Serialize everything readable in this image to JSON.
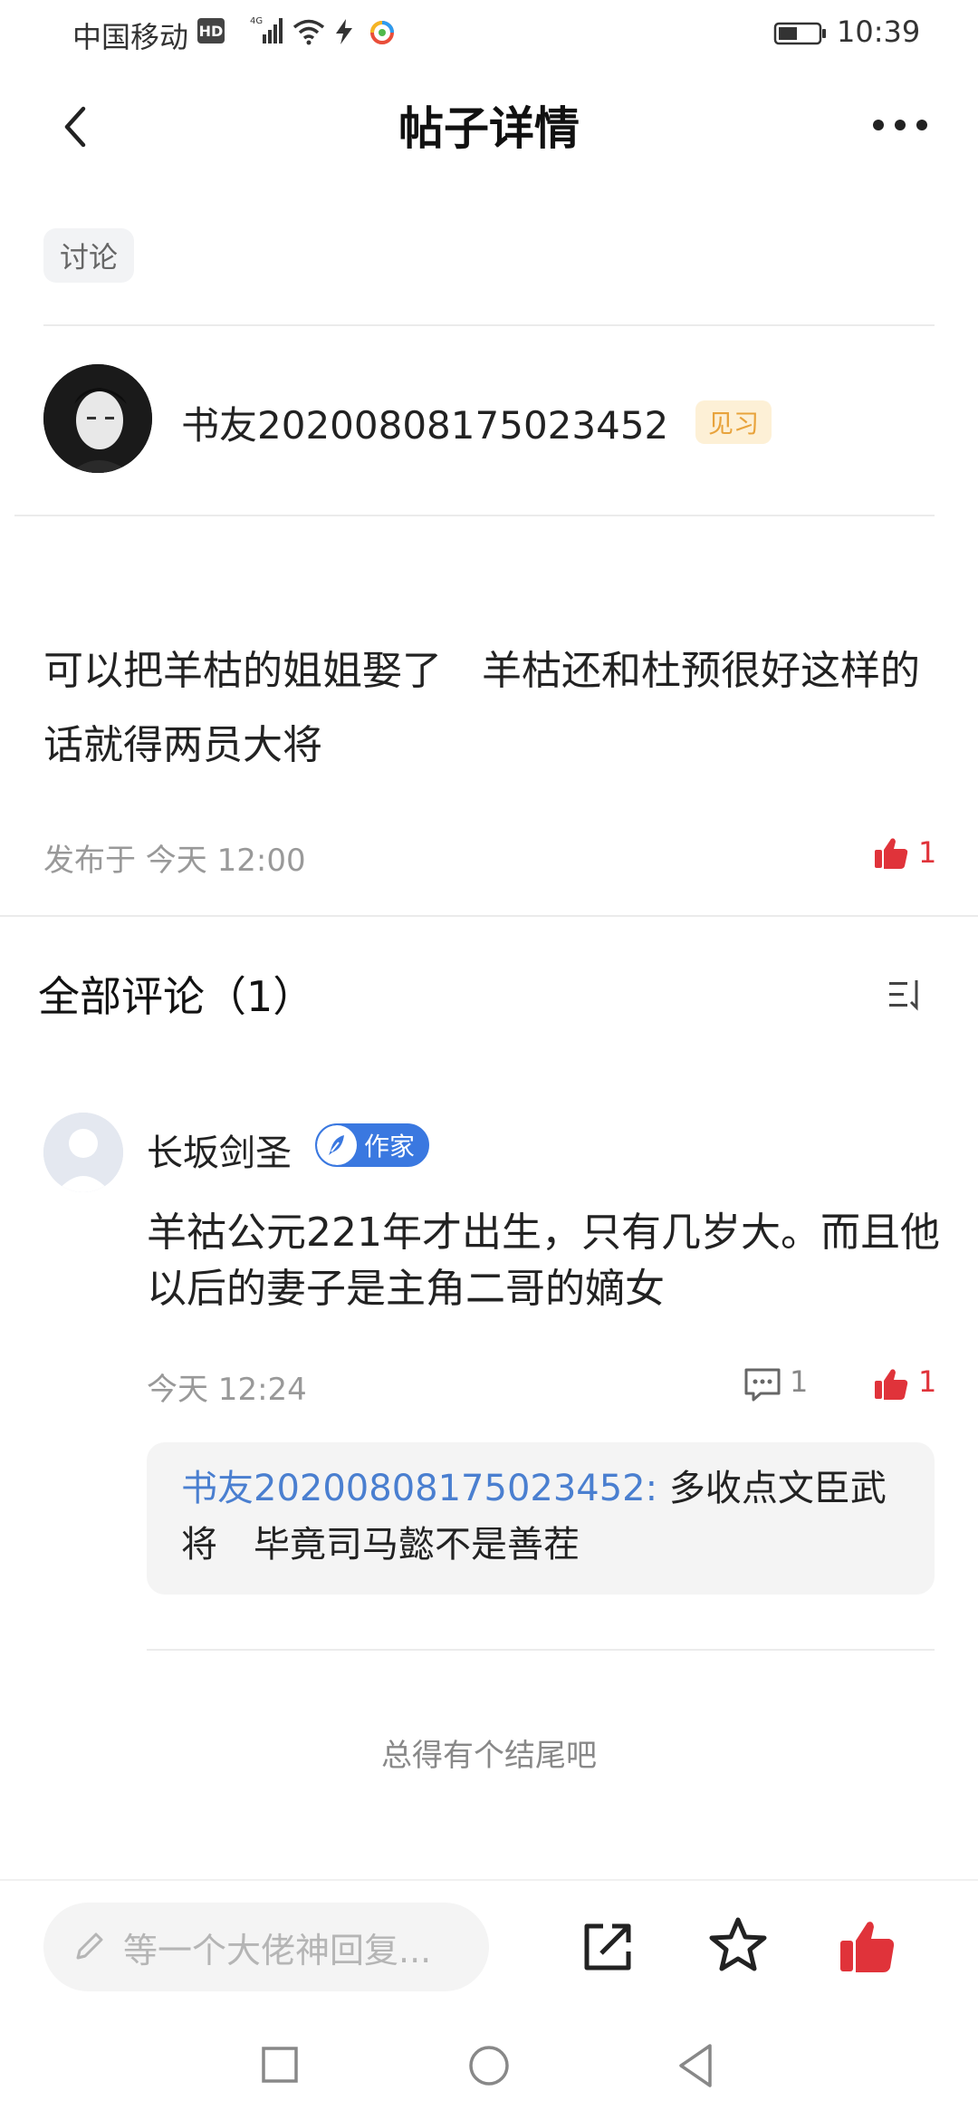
{
  "status_bar": {
    "carrier": "中国移动",
    "hd": "HD",
    "time": "10:39"
  },
  "header": {
    "title": "帖子详情",
    "back_icon": "chevron-left-icon",
    "more_icon": "more-dots-icon"
  },
  "post": {
    "tag": "讨论",
    "author": {
      "name": "书友20200808175023452",
      "level": "见习"
    },
    "body": "可以把羊枯的姐姐娶了　羊枯还和杜预很好这样的话就得两员大将",
    "meta": "发布于 今天 12:00",
    "likes": "1"
  },
  "comments": {
    "heading": "全部评论（1）",
    "items": [
      {
        "author": "长坂剑圣",
        "badge": "作家",
        "body": "羊祜公元221年才出生，只有几岁大。而且他以后的妻子是主角二哥的嫡女",
        "time": "今天 12:24",
        "reply_count": "1",
        "likes": "1",
        "reply": {
          "author": "书友20200808175023452:",
          "text": " 多收点文臣武将　毕竟司马懿不是善茬"
        }
      }
    ],
    "end_note": "总得有个结尾吧"
  },
  "bottom_bar": {
    "input_placeholder": "等一个大佬神回复..."
  },
  "colors": {
    "accent_red": "#e0333a",
    "link_blue": "#4a7fd0",
    "badge_orange": "#e8a33c"
  }
}
